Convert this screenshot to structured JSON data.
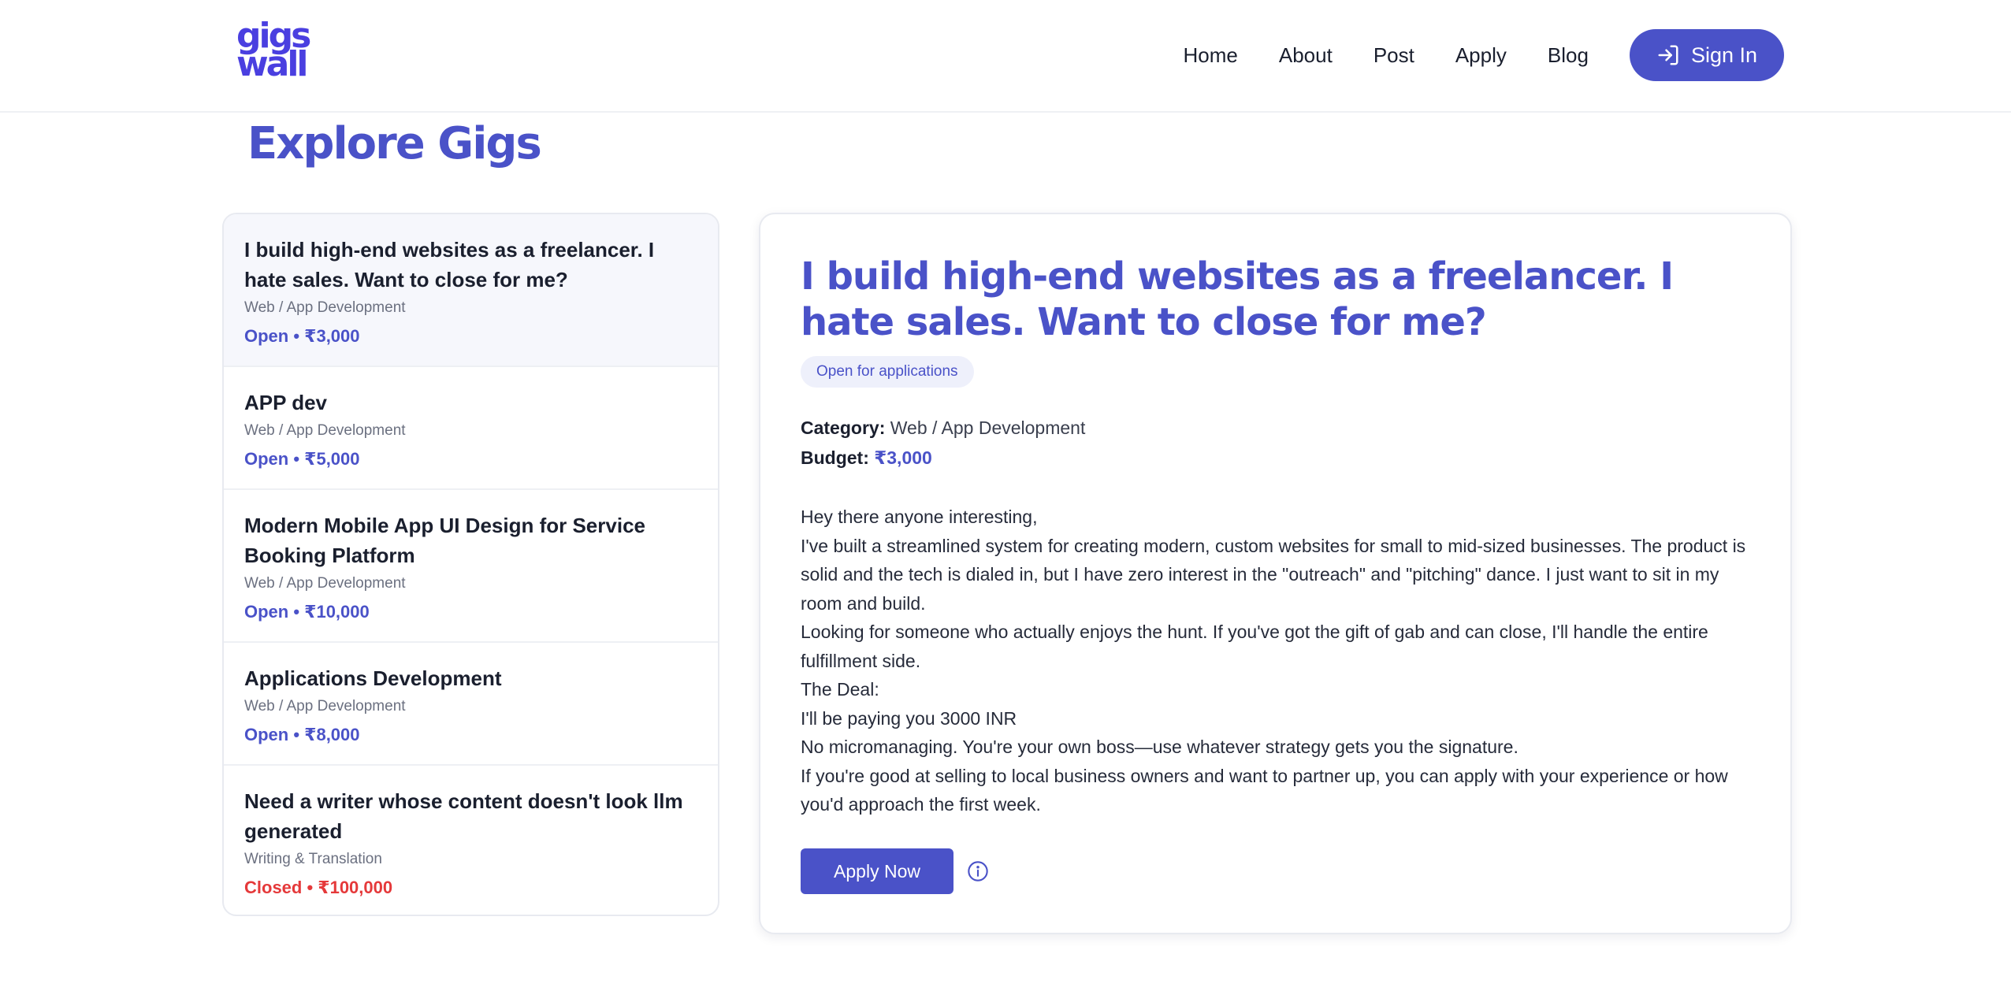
{
  "brand": {
    "logo_line1": "gigs",
    "logo_line2": "wall",
    "accent": "#4a52c8"
  },
  "nav": {
    "items": [
      "Home",
      "About",
      "Post",
      "Apply",
      "Blog"
    ],
    "signin_label": "Sign In"
  },
  "page_title": "Explore Gigs",
  "gigs": [
    {
      "title": "I build high-end websites as a freelancer. I hate sales. Want to close for me?",
      "category": "Web / App Development",
      "status": "Open • ₹3,000"
    },
    {
      "title": "APP dev",
      "category": "Web / App Development",
      "status": "Open • ₹5,000"
    },
    {
      "title": "Modern Mobile App UI Design for Service Booking Platform",
      "category": "Web / App Development",
      "status": "Open • ₹10,000"
    },
    {
      "title": "Applications Development",
      "category": "Web / App Development",
      "status": "Open • ₹8,000"
    },
    {
      "title": "Need a writer whose content doesn't look llm generated",
      "category": "Writing & Translation",
      "status": "Closed • ₹100,000"
    }
  ],
  "detail": {
    "title": "I build high-end websites as a freelancer. I hate sales. Want to close for me?",
    "badge": "Open for applications",
    "category_label": "Category:",
    "category": "Web / App Development",
    "budget_label": "Budget:",
    "budget": "₹3,000",
    "body": [
      "Hey there anyone interesting,",
      "I've built a streamlined system for creating modern, custom websites for small to mid-sized businesses. The product is solid and the tech is dialed in, but I have zero interest in the \"outreach\" and \"pitching\" dance. I just want to sit in my room and build.",
      "Looking for someone who actually enjoys the hunt. If you've got the gift of gab and can close, I'll handle the entire fulfillment side.",
      "The Deal:",
      "I'll be paying you 3000 INR",
      "No micromanaging. You're your own boss—use whatever strategy gets you the signature.",
      "If you're good at selling to local business owners and want to partner up, you can apply with your experience or how you'd approach the first week."
    ],
    "apply_label": "Apply Now"
  }
}
